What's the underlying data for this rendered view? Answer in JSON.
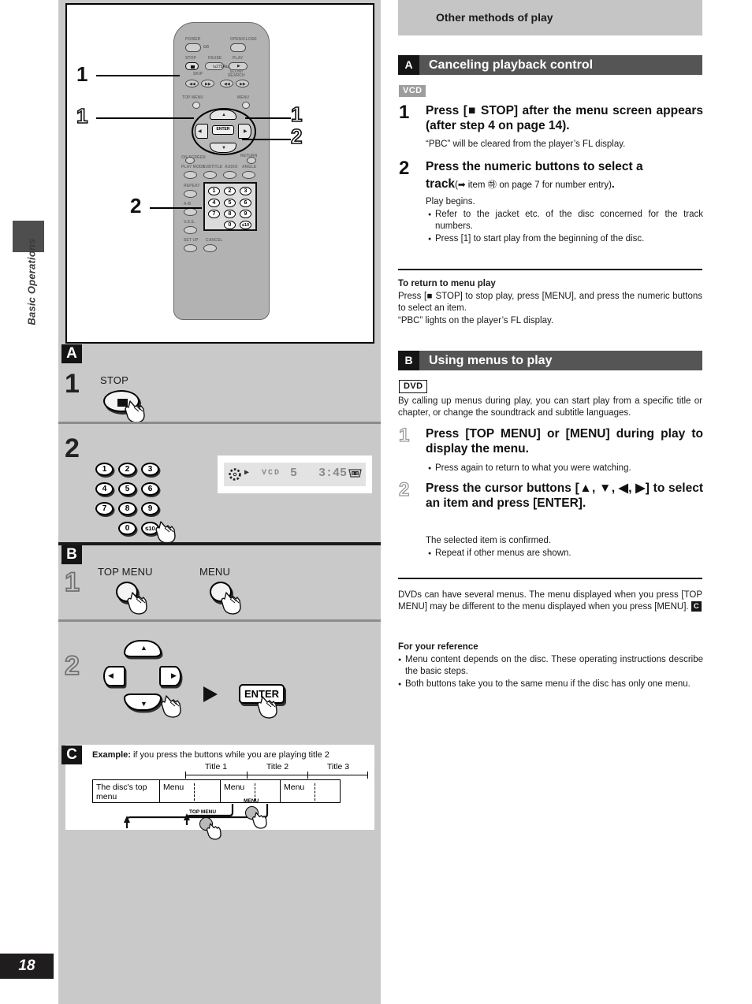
{
  "spine": {
    "label": "Basic Operations",
    "page_number": "18"
  },
  "right": {
    "band_title": "Other methods of play",
    "section_a": {
      "badge": "A",
      "title": "Canceling playback control",
      "disc_tag": "VCD",
      "steps": [
        {
          "num": "1",
          "heading": "Press [■ STOP] after the menu screen appears (after step 4 on page 14).",
          "body": "“PBC” will be cleared from the player’s FL display."
        },
        {
          "num": "2",
          "heading": "Press the numeric buttons to select a",
          "heading2": "track",
          "heading_ref": "(➡ item ㉻ on page 7 for number entry)",
          "body": "Play begins.",
          "bullets": [
            "Refer to the jacket etc. of the disc concerned for the track numbers.",
            "Press [1] to start play from the beginning of the disc."
          ]
        }
      ],
      "note_title": "To return to menu play",
      "note_body": "Press [■ STOP] to stop play, press [MENU], and press the numeric buttons to select an item.",
      "note_body2": "“PBC” lights on the player’s FL display."
    },
    "section_b": {
      "badge": "B",
      "title": "Using menus to play",
      "disc_tag": "DVD",
      "intro": "By calling up menus during play, you can start play from a specific title or chapter, or change the soundtrack and subtitle languages.",
      "steps": [
        {
          "num": "1",
          "heading": "Press [TOP MENU] or [MENU] during play to display the menu.",
          "bullets": [
            "Press again to return to what you were watching."
          ]
        },
        {
          "num": "2",
          "heading": "Press the cursor buttons [▲, ▼, ◀, ▶] to select an item and press [ENTER].",
          "body": "The selected item is confirmed.",
          "bullets": [
            "Repeat if other menus are shown."
          ]
        }
      ],
      "after_note_a": "DVDs can have several menus. The menu displayed when you press [TOP MENU] may be different to the menu displayed when you press [MENU].",
      "after_note_badge": "C",
      "ref_title": "For your reference",
      "ref_bullets": [
        "Menu content depends on the disc. These operating instructions describe the basic steps.",
        "Both buttons take you to the same menu if the disc has only one menu."
      ]
    }
  },
  "remote": {
    "labels": {
      "power": "POWER",
      "open_close": "OPEN/CLOSE",
      "stop": "STOP",
      "pause": "PAUSE",
      "play": "PLAY",
      "skip": "SKIP",
      "slow_search": "SLOW/\nSEARCH",
      "top_menu": "TOP MENU",
      "menu": "MENU",
      "enter": "ENTER",
      "on_screen": "ON SCREEN",
      "play_mode": "PLAY MODE",
      "subtitle": "SUBTITLE",
      "audio": "AUDIO",
      "angle": "ANGLE",
      "return": "RETURN",
      "repeat": "REPEAT",
      "ab": "A-B",
      "vss": "V.S.S.",
      "setup": "SET UP",
      "cancel": "CANCEL",
      "power_glyph": "⏻/I"
    },
    "numbers": [
      "1",
      "2",
      "3",
      "4",
      "5",
      "6",
      "7",
      "8",
      "9",
      "0",
      "≤10"
    ],
    "callouts": [
      {
        "id": "stop",
        "value": "1"
      },
      {
        "id": "top-menu",
        "value": "1"
      },
      {
        "id": "menu",
        "value": "1"
      },
      {
        "id": "cursor-right",
        "value": "2"
      },
      {
        "id": "numeric",
        "value": "2"
      }
    ]
  },
  "left_panels": {
    "a_badge": "A",
    "b_badge": "B",
    "c_badge": "C",
    "a1": {
      "num": "1",
      "button_label": "STOP"
    },
    "a2": {
      "num": "2",
      "keys": [
        "1",
        "2",
        "3",
        "4",
        "5",
        "6",
        "7",
        "8",
        "9",
        "0",
        "≤10"
      ],
      "fl_display": {
        "disc_icon": "disc-spin",
        "play_icon": "▶",
        "type": "VCD",
        "track": "5",
        "time": "3:45",
        "right_icon": "remote-cart"
      }
    },
    "b1": {
      "num": "1",
      "left_label": "TOP MENU",
      "right_label": "MENU"
    },
    "b2": {
      "num": "2",
      "enter_label": "ENTER",
      "arrows": [
        "▲",
        "◀",
        "▶",
        "▼"
      ]
    }
  },
  "example": {
    "badge": "C",
    "title_bold": "Example:",
    "title_rest": " if you press the buttons while you are playing title 2",
    "titles": [
      "Title 1",
      "Title 2",
      "Title 3"
    ],
    "top_menu_cell": "The disc's top menu",
    "menu_cells": [
      "Menu",
      "Menu",
      "Menu"
    ],
    "btn_top_menu": "TOP MENU",
    "btn_menu": "MENU"
  }
}
